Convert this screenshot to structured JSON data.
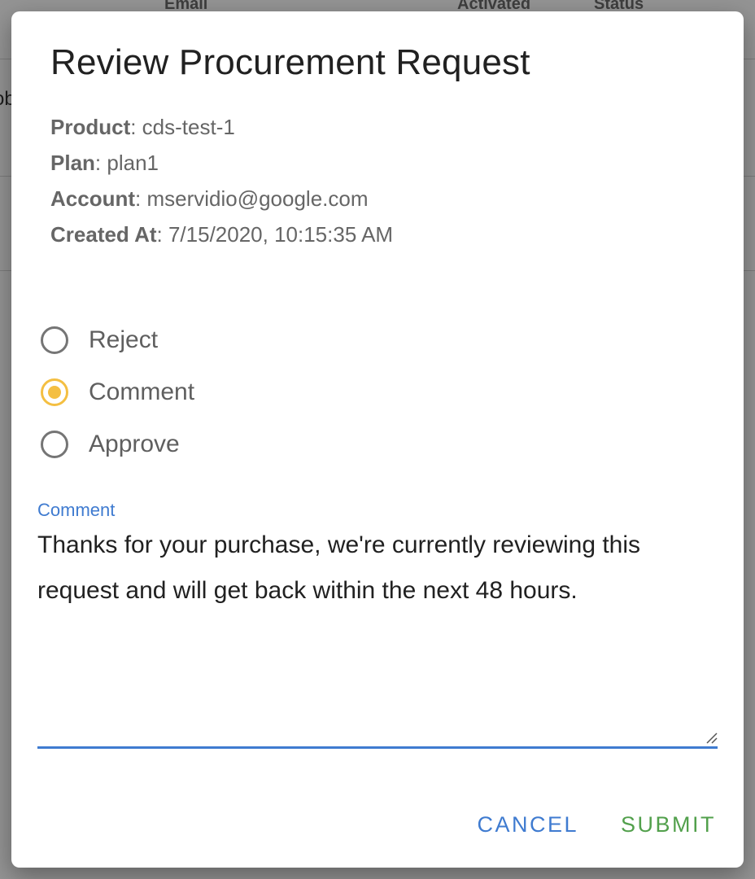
{
  "background": {
    "columns": [
      "Email",
      "Activated",
      "Status"
    ],
    "row_cell_fragment": "ob"
  },
  "dialog": {
    "title": "Review Procurement Request",
    "meta": [
      {
        "key": "Product",
        "value": ": cds-test-1"
      },
      {
        "key": "Plan",
        "value": ": plan1"
      },
      {
        "key": "Account",
        "value": ": mservidio@google.com"
      },
      {
        "key": "Created At",
        "value": ": 7/15/2020, 10:15:35 AM"
      }
    ],
    "options": [
      {
        "label": "Reject",
        "selected": false
      },
      {
        "label": "Comment",
        "selected": true
      },
      {
        "label": "Approve",
        "selected": false
      }
    ],
    "comment_field": {
      "label": "Comment",
      "value": "Thanks for your purchase, we're currently reviewing this request and will get back within the next 48 hours."
    },
    "actions": {
      "cancel_label": "CANCEL",
      "submit_label": "SUBMIT"
    }
  },
  "colors": {
    "accent_blue": "#3f7bd0",
    "radio_selected": "#f4bf42",
    "submit_green": "#52a04c"
  }
}
